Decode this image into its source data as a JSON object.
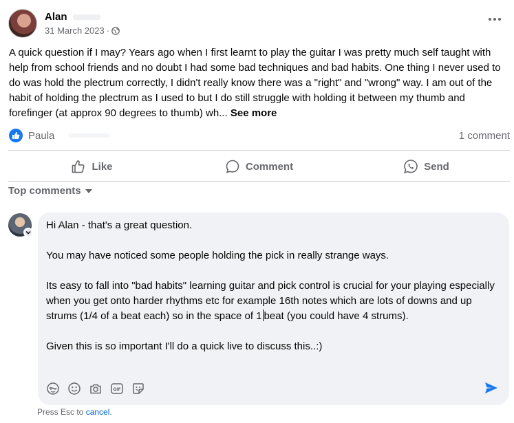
{
  "post": {
    "author": "Alan",
    "date": "31 March 2023",
    "meta_separator": "·",
    "audience_icon": "globe-icon",
    "body": "A quick question if I may?  Years ago when I first learnt to play the guitar I was pretty much self taught with help from school friends and no doubt I had some bad techniques and bad habits.  One thing I never used to do was hold the plectrum correctly, I didn't really know there was a \"right\" and \"wrong\" way.  I am out of the habit of holding the plectrum as I used to but I do still struggle with holding it between my thumb and forefinger (at approx 90 degrees to thumb)  wh... ",
    "see_more": "See more"
  },
  "reactions": {
    "reactor": "Paula",
    "comment_count": "1 comment",
    "icon": "like-icon"
  },
  "actions": {
    "like": "Like",
    "comment": "Comment",
    "send": "Send"
  },
  "comments_sort": {
    "label": "Top comments"
  },
  "reply": {
    "p1": "Hi Alan - that's a great question.",
    "p2": "You may have noticed some people holding the pick in really strange ways.",
    "p3_before_cursor": "Its easy to fall into \"bad habits\" learning guitar and pick control is crucial for your playing especially when you get onto harder rhythms etc for example 16th notes which are lots of downs and up strums (1/4 of a beat each) so in the space of 1",
    "p3_after_cursor": "beat (you could have 4 strums).",
    "p4": "Given this is so important I'll do a quick live to discuss this..:)"
  },
  "composer": {
    "icons": [
      "avatar-sticker-icon",
      "emoji-icon",
      "camera-icon",
      "gif-icon",
      "sticker-icon"
    ],
    "gif_label": "GIF",
    "send_icon": "send-icon"
  },
  "footer": {
    "press_esc": "Press Esc to ",
    "cancel": "cancel",
    "period": "."
  },
  "colors": {
    "accent": "#1877f2",
    "secondary_text": "#65676b",
    "comment_bg": "#f0f2f5"
  }
}
